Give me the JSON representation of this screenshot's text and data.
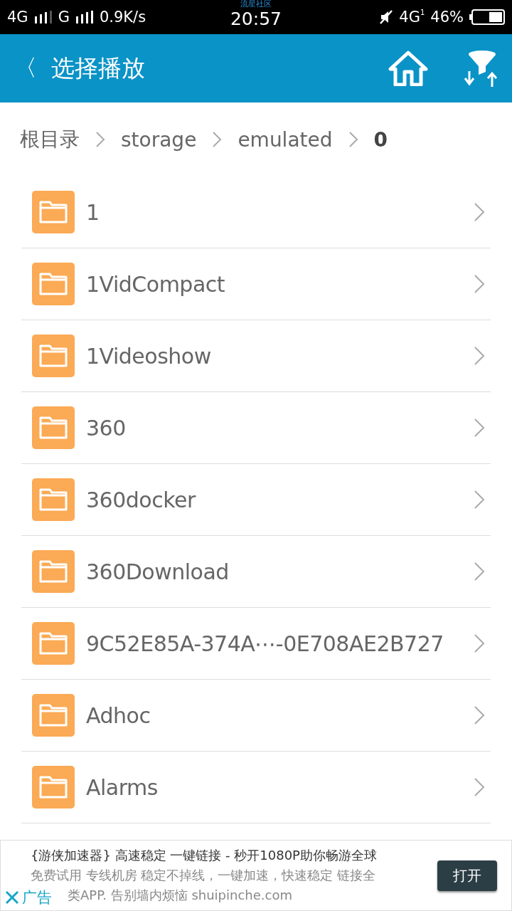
{
  "status_bar": {
    "network1": "4G",
    "network2": "G",
    "speed": "0.9K/s",
    "carrier_label": "流星社区",
    "time": "20:57",
    "network3": "4G",
    "network3_sub": "1",
    "battery": "46%"
  },
  "header": {
    "back": "〈",
    "title": "选择播放"
  },
  "breadcrumb": [
    {
      "label": "根目录",
      "selected": false
    },
    {
      "label": "storage",
      "selected": false
    },
    {
      "label": "emulated",
      "selected": false
    },
    {
      "label": "0",
      "selected": true
    }
  ],
  "folders": [
    {
      "name": "1"
    },
    {
      "name": "1VidCompact"
    },
    {
      "name": "1Videoshow"
    },
    {
      "name": "360"
    },
    {
      "name": "360docker"
    },
    {
      "name": "360Download"
    },
    {
      "name": "9C52E85A-374A⋯-0E708AE2B727"
    },
    {
      "name": "Adhoc"
    },
    {
      "name": "Alarms"
    }
  ],
  "ad": {
    "title": "{游侠加速器} 高速稳定 一键链接 - 秒开1080P助你畅游全球",
    "line2": "免费试用 专线机房 稳定不掉线，一键加速，快速稳定 链接全",
    "line3": "类APP. 告别墙内烦恼 shuipinche.com",
    "label": "广告",
    "button": "打开"
  }
}
